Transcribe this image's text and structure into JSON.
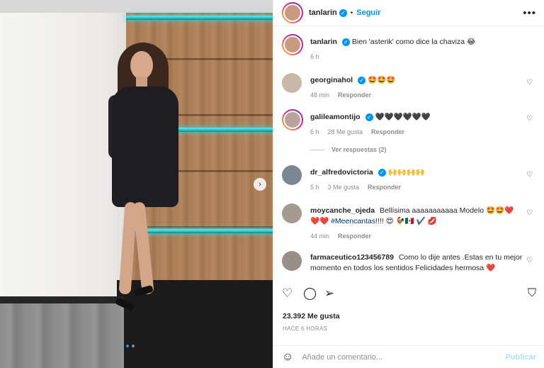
{
  "colors": {
    "accent": "#0095f6",
    "muted": "#8e8e8e",
    "text": "#262626",
    "link": "#00376b"
  },
  "header": {
    "username": "tanlarin",
    "separator": "•",
    "follow_label": "Seguir",
    "more_icon": "more-horizontal-icon"
  },
  "caption": {
    "username": "tanlarin",
    "text": "Bien 'asterik' como dice la chaviza 😂",
    "time": "6 h"
  },
  "comments": [
    {
      "username": "georginahol",
      "verified": true,
      "text": "🤩🤩🤩",
      "time": "48 min",
      "likes": "",
      "reply": "Responder"
    },
    {
      "username": "galileamontijo",
      "verified": true,
      "text": "🖤🖤🖤🖤🖤🖤",
      "time": "6 h",
      "likes": "28 Me gusta",
      "reply": "Responder",
      "view_replies": "Ver respuestas (2)"
    },
    {
      "username": "dr_alfredovictoria",
      "verified": true,
      "text": "🙌🙌🙌🙌",
      "time": "5 h",
      "likes": "3 Me gusta",
      "reply": "Responder"
    },
    {
      "username": "moycanche_ojeda",
      "verified": false,
      "text_before": "Bellísima aaaaaaaaaaa Modelo 🤩🤩❤️ ❤️❤️ ",
      "tag": "#Meencantas",
      "text_after": "!!!! 😍 🐓🇲🇽 ✔️ 💋",
      "time": "44 min",
      "likes": "",
      "reply": "Responder"
    },
    {
      "username": "farmaceutico123456789",
      "verified": false,
      "text": "Como lo dije antes .Estas en tu mejor momento en todos los sentidos Felicidades hermosa ❤️",
      "time": "",
      "likes": "",
      "reply": ""
    }
  ],
  "actions": {
    "like_icon": "heart-icon",
    "comment_icon": "comment-icon",
    "share_icon": "share-icon",
    "save_icon": "bookmark-icon"
  },
  "likes": "23.392 Me gusta",
  "posted": "HACE 6 HORAS",
  "add_comment": {
    "placeholder": "Añade un comentario...",
    "post_label": "Publicar",
    "emoji_icon": "emoji-icon"
  },
  "carousel": {
    "current": 1,
    "total": 2,
    "next_icon": "chevron-right-icon"
  }
}
